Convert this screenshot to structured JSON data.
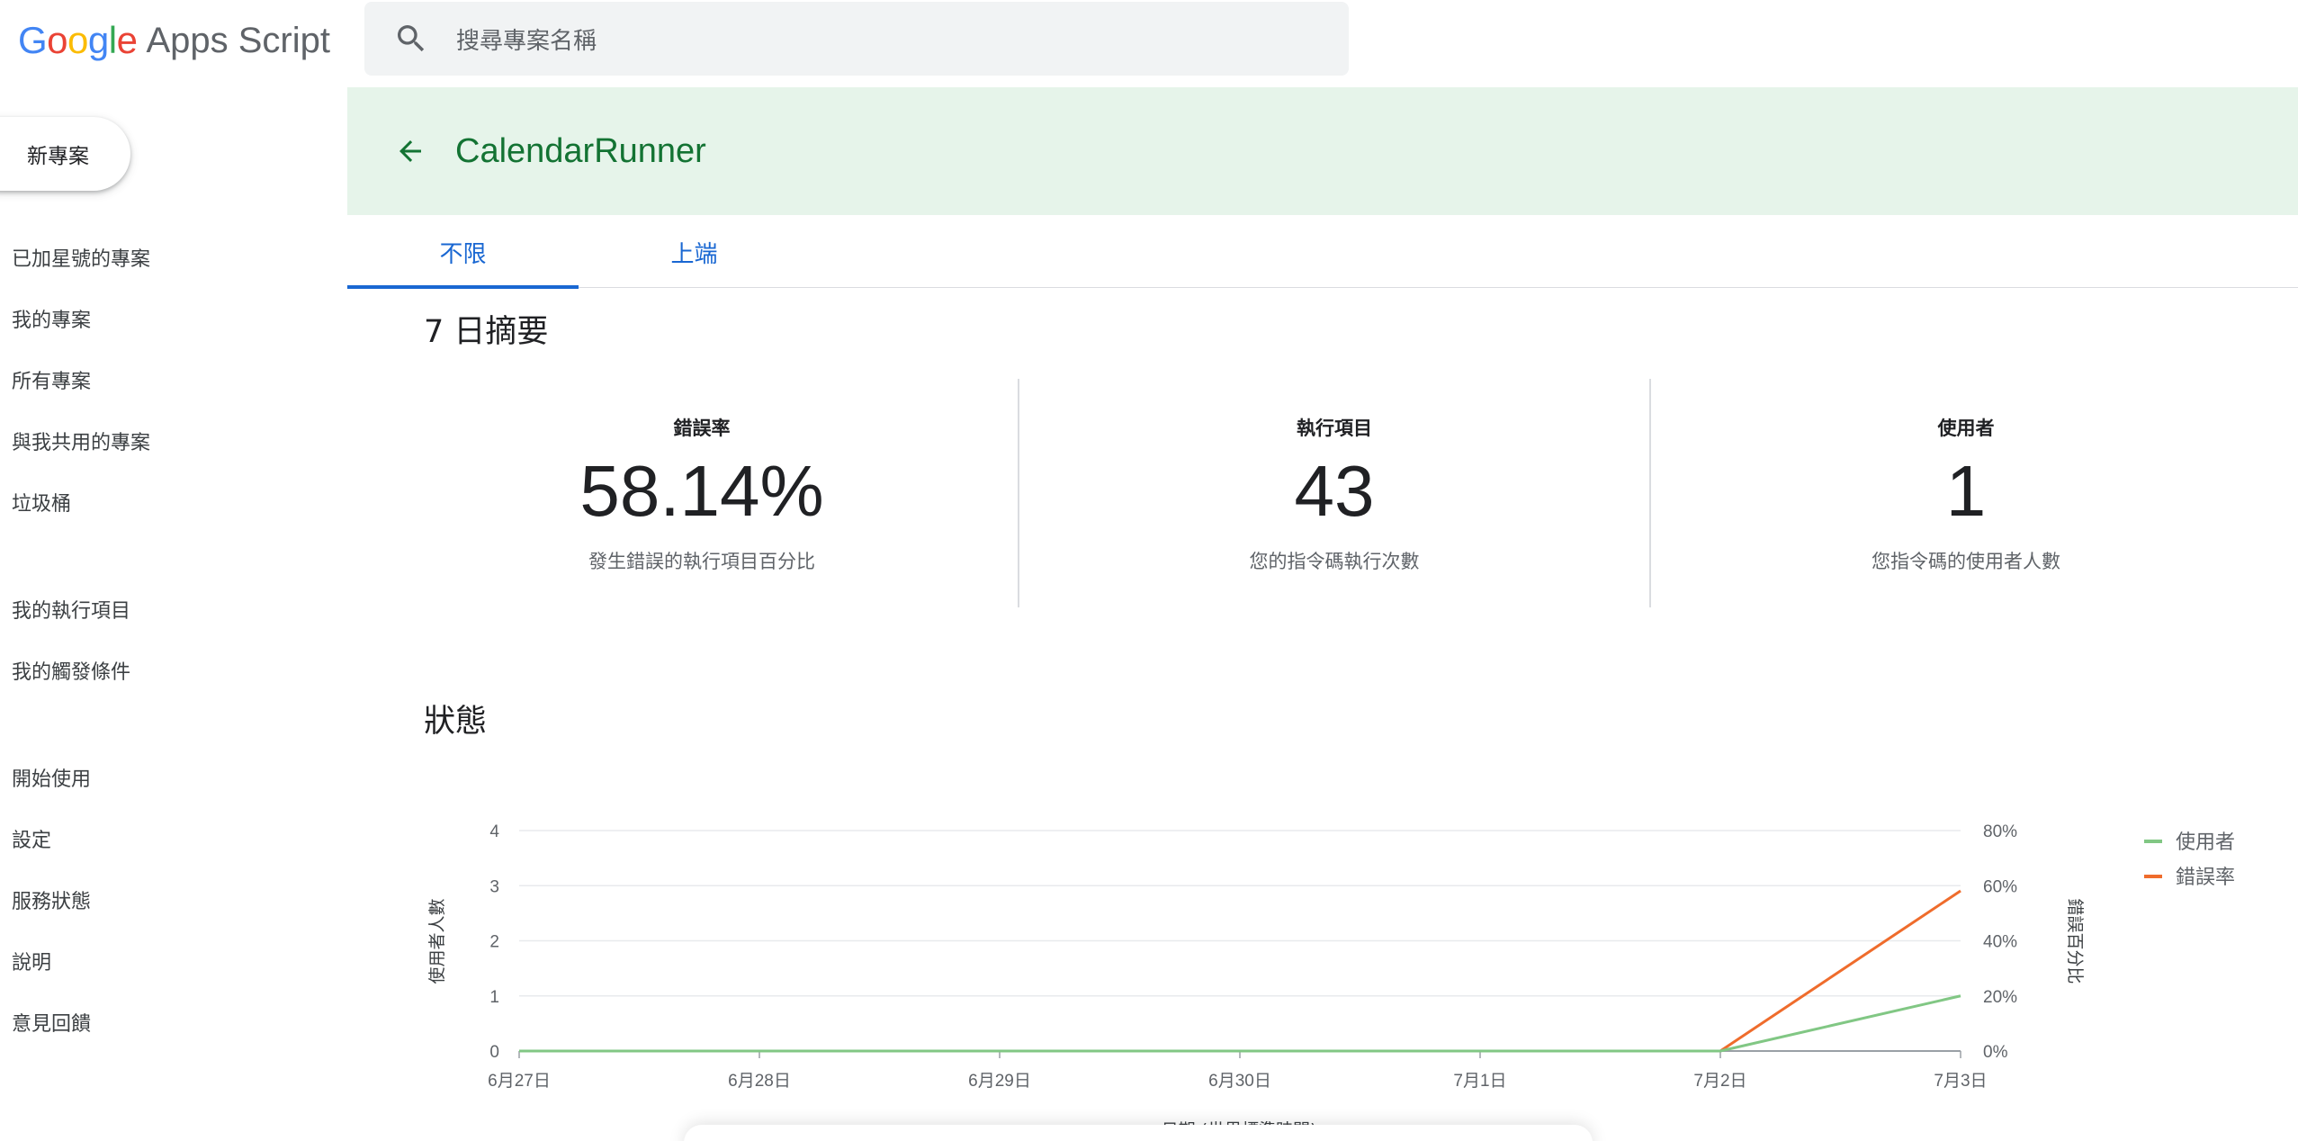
{
  "app": {
    "logo_google": [
      {
        "ch": "G",
        "color": "#4285F4"
      },
      {
        "ch": "o",
        "color": "#EA4335"
      },
      {
        "ch": "o",
        "color": "#FBBC05"
      },
      {
        "ch": "g",
        "color": "#4285F4"
      },
      {
        "ch": "l",
        "color": "#34A853"
      },
      {
        "ch": "e",
        "color": "#EA4335"
      }
    ],
    "logo_apps_script": "Apps Script"
  },
  "search": {
    "placeholder": "搜尋專案名稱",
    "icon": "search-icon"
  },
  "sidebar": {
    "new_project": "新專案",
    "items": [
      {
        "label": "已加星號的專案"
      },
      {
        "label": "我的專案"
      },
      {
        "label": "所有專案"
      },
      {
        "label": "與我共用的專案"
      },
      {
        "label": "垃圾桶"
      },
      {
        "label": "我的執行項目"
      },
      {
        "label": "我的觸發條件"
      },
      {
        "label": "開始使用"
      },
      {
        "label": "設定"
      },
      {
        "label": "服務狀態"
      },
      {
        "label": "說明"
      },
      {
        "label": "意見回饋"
      }
    ]
  },
  "project": {
    "title": "CalendarRunner",
    "back_icon": "arrow-back-icon"
  },
  "tabs": [
    {
      "label": "不限",
      "active": true
    },
    {
      "label": "上端",
      "active": false
    }
  ],
  "summary": {
    "title": "7 日摘要",
    "cards": [
      {
        "label": "錯誤率",
        "value": "58.14%",
        "desc": "發生錯誤的執行項目百分比"
      },
      {
        "label": "執行項目",
        "value": "43",
        "desc": "您的指令碼執行次數"
      },
      {
        "label": "使用者",
        "value": "1",
        "desc": "您指令碼的使用者人數"
      }
    ]
  },
  "status": {
    "title": "狀態"
  },
  "colors": {
    "users": "#81c784",
    "error": "#ef6c2c",
    "accent": "#1967d2",
    "header_bg": "#e6f4ea",
    "header_text": "#137333"
  },
  "chart_data": {
    "type": "line",
    "x": [
      "6月27日",
      "6月28日",
      "6月29日",
      "6月30日",
      "7月1日",
      "7月2日",
      "7月3日"
    ],
    "xlabel": "日期 (世界標準時間)",
    "ylabel_left": "使用者人數",
    "ylabel_right": "錯誤百分比",
    "y_left_ticks": [
      "0",
      "1",
      "2",
      "3",
      "4"
    ],
    "y_right_ticks": [
      "0%",
      "20%",
      "40%",
      "60%",
      "80%"
    ],
    "ylim_left": [
      0,
      4
    ],
    "ylim_right": [
      0,
      80
    ],
    "grid": true,
    "legend_position": "right",
    "series": [
      {
        "name": "使用者",
        "axis": "left",
        "values": [
          0,
          0,
          0,
          0,
          0,
          0,
          1
        ],
        "color": "#81c784"
      },
      {
        "name": "錯誤率",
        "axis": "right",
        "values": [
          0,
          0,
          0,
          0,
          0,
          0,
          58.14
        ],
        "color": "#ef6c2c"
      }
    ]
  }
}
